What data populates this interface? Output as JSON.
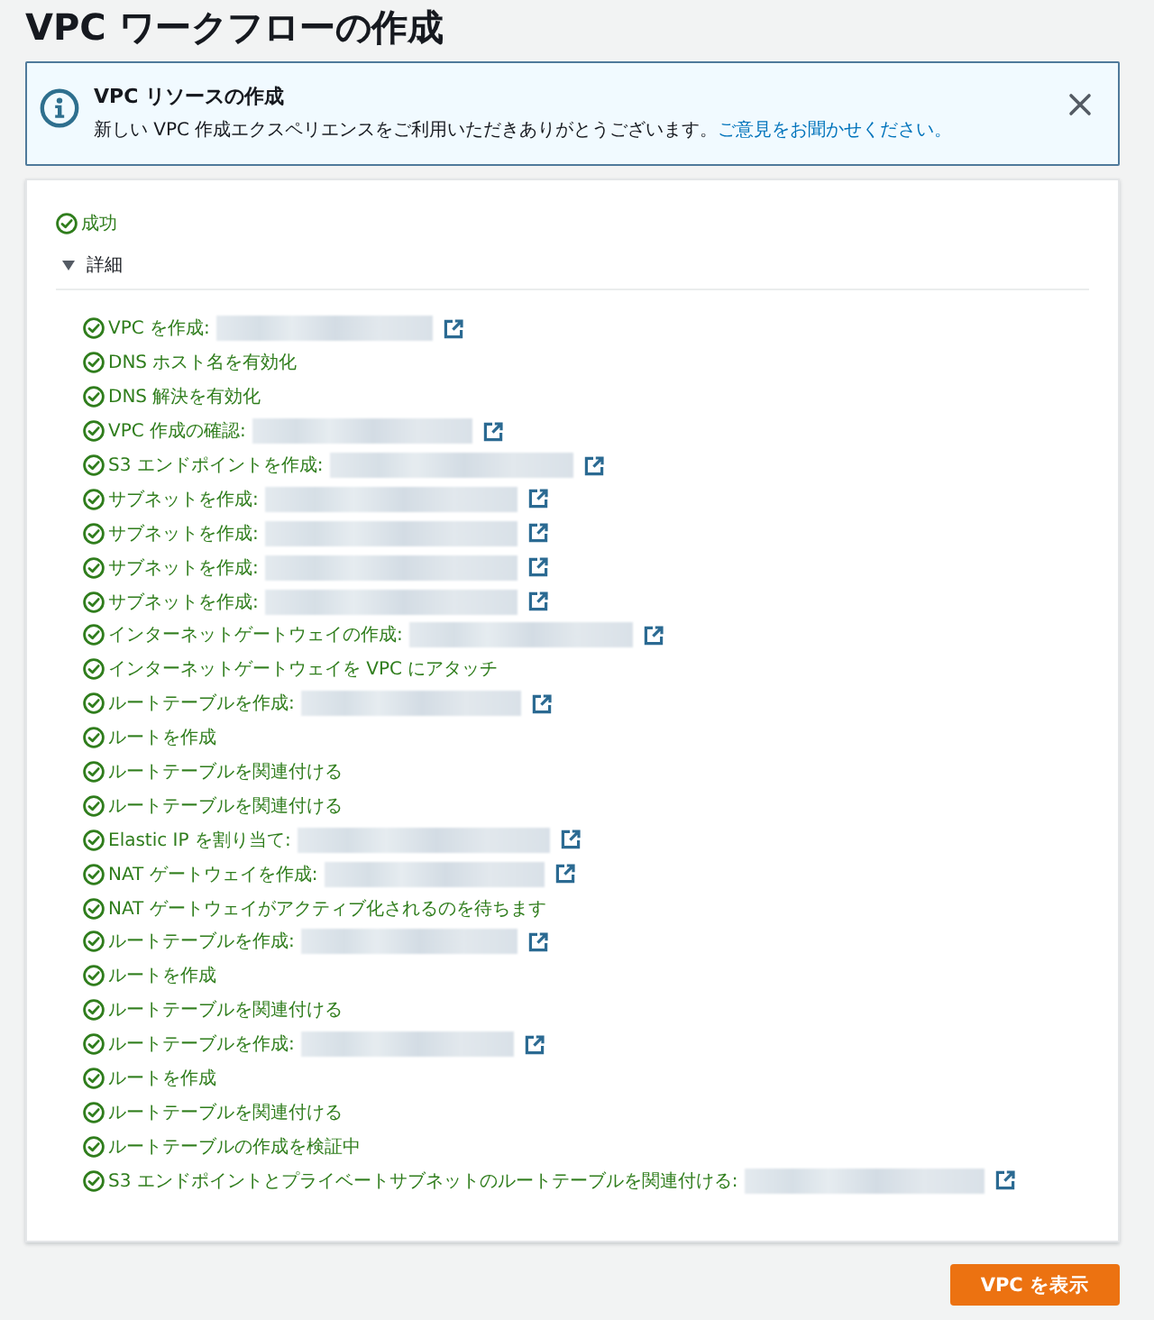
{
  "page": {
    "title": "VPC ワークフローの作成"
  },
  "alert": {
    "title": "VPC リソースの作成",
    "message": "新しい VPC 作成エクスペリエンスをご利用いただきありがとうございます。",
    "link": "ご意見をお聞かせください。"
  },
  "status": {
    "label": "成功",
    "kind": "success"
  },
  "details": {
    "label": "詳細",
    "expanded": true,
    "steps": [
      {
        "label": "VPC を作成:",
        "kind": "resource"
      },
      {
        "label": "DNS ホスト名を有効化",
        "kind": "plain"
      },
      {
        "label": "DNS 解決を有効化",
        "kind": "plain"
      },
      {
        "label": "VPC 作成の確認:",
        "kind": "resource"
      },
      {
        "label": "S3 エンドポイントを作成:",
        "kind": "resource"
      },
      {
        "label": "サブネットを作成:",
        "kind": "resource"
      },
      {
        "label": "サブネットを作成:",
        "kind": "resource"
      },
      {
        "label": "サブネットを作成:",
        "kind": "resource"
      },
      {
        "label": "サブネットを作成:",
        "kind": "resource"
      },
      {
        "label": "インターネットゲートウェイの作成:",
        "kind": "resource"
      },
      {
        "label": "インターネットゲートウェイを VPC にアタッチ",
        "kind": "plain"
      },
      {
        "label": "ルートテーブルを作成:",
        "kind": "resource"
      },
      {
        "label": "ルートを作成",
        "kind": "plain"
      },
      {
        "label": "ルートテーブルを関連付ける",
        "kind": "plain"
      },
      {
        "label": "ルートテーブルを関連付ける",
        "kind": "plain"
      },
      {
        "label": "Elastic IP を割り当て:",
        "kind": "resource"
      },
      {
        "label": "NAT ゲートウェイを作成:",
        "kind": "resource"
      },
      {
        "label": "NAT ゲートウェイがアクティブ化されるのを待ちます",
        "kind": "plain"
      },
      {
        "label": "ルートテーブルを作成:",
        "kind": "resource"
      },
      {
        "label": "ルートを作成",
        "kind": "plain"
      },
      {
        "label": "ルートテーブルを関連付ける",
        "kind": "plain"
      },
      {
        "label": "ルートテーブルを作成:",
        "kind": "resource"
      },
      {
        "label": "ルートを作成",
        "kind": "plain"
      },
      {
        "label": "ルートテーブルを関連付ける",
        "kind": "plain"
      },
      {
        "label": "ルートテーブルの作成を検証中",
        "kind": "plain"
      },
      {
        "label": "S3 エンドポイントとプライベートサブネットのルートテーブルを関連付ける:",
        "kind": "resource"
      }
    ]
  },
  "buttons": [
    {
      "label": "VPC を表示",
      "kind": "primary"
    }
  ]
}
